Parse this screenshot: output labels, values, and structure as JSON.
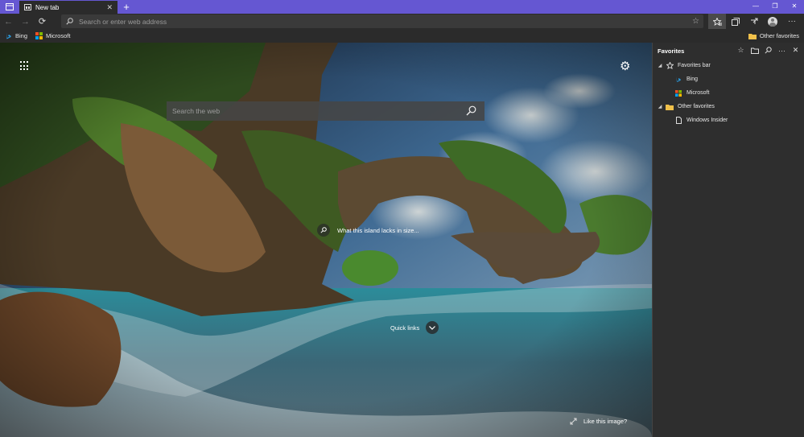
{
  "browser": {
    "tab": {
      "title": "New tab",
      "close": "✕"
    },
    "new_tab": "+",
    "window_controls": {
      "minimize": "—",
      "restore": "❐",
      "close": "✕"
    },
    "address": {
      "placeholder": "Search or enter web address"
    },
    "icons": [
      "tab-actions-icon",
      "back-icon",
      "forward-icon",
      "refresh-icon",
      "search-icon",
      "favorite-star-icon",
      "favorites-icon",
      "collections-icon",
      "share-icon",
      "profile-icon",
      "more-icon"
    ]
  },
  "favorites_bar": {
    "items": [
      {
        "label": "Bing",
        "icon": "bing-icon"
      },
      {
        "label": "Microsoft",
        "icon": "microsoft-icon"
      }
    ],
    "other": "Other favorites"
  },
  "newtab": {
    "search_placeholder": "Search the web",
    "caption": "What this island lacks in size...",
    "quick_links": "Quick links",
    "like": "Like this image?"
  },
  "favorites_panel": {
    "title": "Favorites",
    "tree": [
      {
        "label": "Favorites bar",
        "level": 0,
        "expanded": true,
        "icon": "star-icon"
      },
      {
        "label": "Bing",
        "level": 1,
        "icon": "bing-icon"
      },
      {
        "label": "Microsoft",
        "level": 1,
        "icon": "microsoft-icon"
      },
      {
        "label": "Other favorites",
        "level": 0,
        "expanded": true,
        "icon": "folder-icon"
      },
      {
        "label": "Windows Insider",
        "level": 1,
        "icon": "page-icon"
      }
    ]
  },
  "colors": {
    "accent": "#6557d2",
    "chrome": "#2b2b2b",
    "panel": "#2e2e2e"
  }
}
